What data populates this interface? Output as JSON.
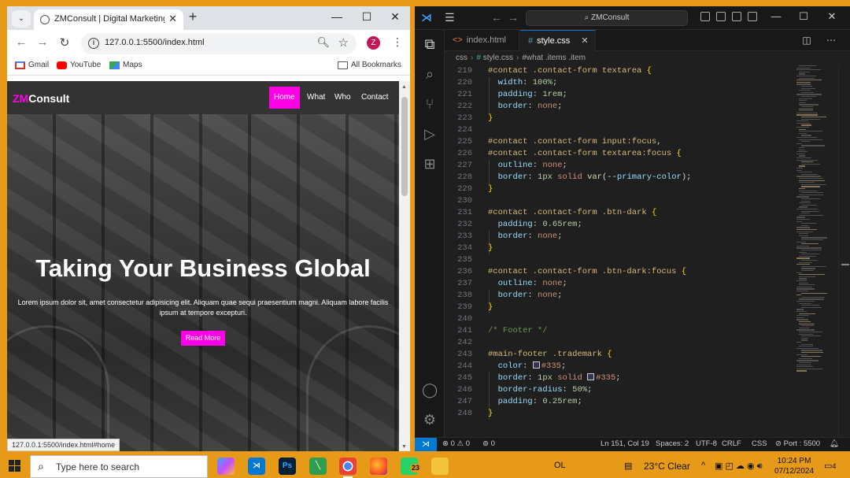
{
  "chrome": {
    "tab_title": "ZMConsult | Digital Marketing A",
    "new_tab": "+",
    "url": "127.0.0.1:5500/index.html",
    "profile_initial": "Z",
    "bookmarks": [
      {
        "label": "Gmail",
        "icon": "gmail-icon"
      },
      {
        "label": "YouTube",
        "icon": "youtube-icon"
      },
      {
        "label": "Maps",
        "icon": "maps-icon"
      }
    ],
    "all_bookmarks": "All Bookmarks",
    "status_url": "127.0.0.1:5500/index.html#home"
  },
  "site": {
    "logo_accent": "ZM",
    "logo_rest": "Consult",
    "nav": [
      "Home",
      "What",
      "Who",
      "Contact"
    ],
    "active_nav": "Home",
    "hero_title": "Taking Your Business Global",
    "hero_text": "Lorem ipsum dolor sit, amet consectetur adipisicing elit. Aliquam quae sequi praesentium magni. Aliquam labore facilis ipsum at tempore excepturi.",
    "cta": "Read More",
    "accent_color": "#ff00e6"
  },
  "vscode": {
    "command_center": "ZMConsult",
    "tabs": [
      {
        "label": "index.html",
        "icon": "<>",
        "active": false
      },
      {
        "label": "style.css",
        "icon": "#",
        "active": true
      }
    ],
    "breadcrumb": [
      "css",
      "style.css",
      "#what .items .item"
    ],
    "status": {
      "problems": "0",
      "warnings": "0",
      "ports": "0",
      "cursor": "Ln 151, Col 19",
      "spaces": "Spaces: 2",
      "encoding": "UTF-8",
      "eol": "CRLF",
      "language": "CSS",
      "port": "Port : 5500"
    }
  },
  "taskbar": {
    "search_placeholder": "Type here to search",
    "whatsapp_badge": "23",
    "ime": "OL",
    "weather": "23°C  Clear",
    "time": "10:24 PM",
    "date": "07/12/2024",
    "notifications": "4"
  }
}
